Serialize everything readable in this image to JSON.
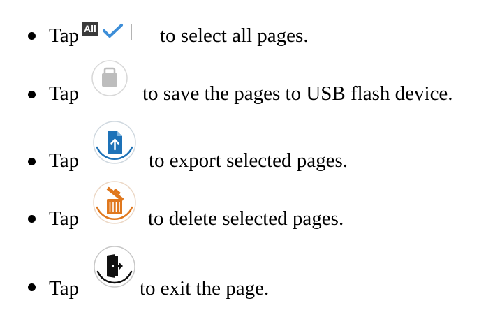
{
  "items": [
    {
      "tap": "Tap",
      "icon": "select-all-icon",
      "icon_label": "All",
      "text": "to select all pages."
    },
    {
      "tap": "Tap",
      "icon": "usb-save-icon",
      "text": "to save the pages to USB flash device."
    },
    {
      "tap": "Tap",
      "icon": "export-icon",
      "text": "to export selected pages."
    },
    {
      "tap": "Tap",
      "icon": "delete-icon",
      "text": "to delete selected pages."
    },
    {
      "tap": "Tap",
      "icon": "exit-icon",
      "text": "to exit the page."
    }
  ],
  "colors": {
    "select_box": "#3a3a3a",
    "check": "#3d8ed8",
    "lock_gray": "#bdbdbd",
    "export_blue": "#1d72b8",
    "delete_orange": "#e0781e",
    "exit_black": "#111111"
  }
}
